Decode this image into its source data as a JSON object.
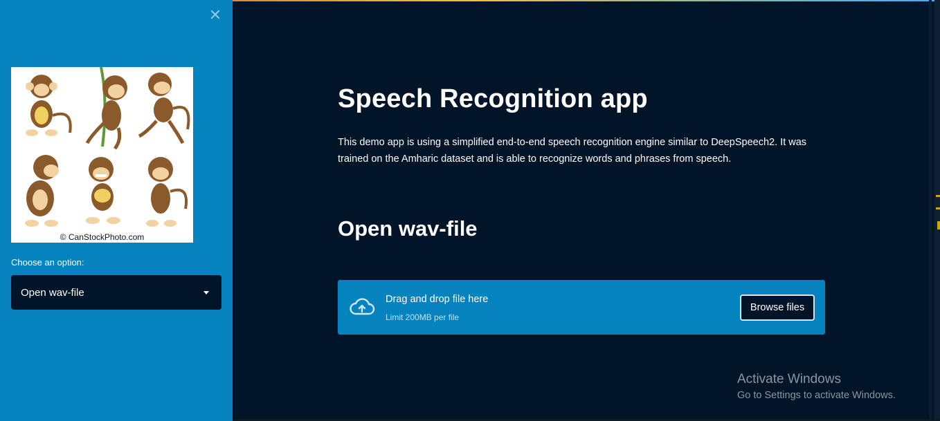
{
  "sidebar": {
    "close_icon": "close-icon",
    "image_credit": "© CanStockPhoto.com",
    "select_label": "Choose an option:",
    "select_value": "Open wav-file"
  },
  "main": {
    "title": "Speech Recognition app",
    "description": "This demo app is using a simplified end-to-end speech recognition engine similar to DeepSpeech2. It was trained on the Amharic dataset and is able to recognize words and phrases from speech.",
    "subtitle": "Open wav-file",
    "uploader": {
      "icon": "cloud-upload-icon",
      "drag_text": "Drag and drop file here",
      "limit_text": "Limit 200MB per file",
      "browse_label": "Browse files"
    }
  },
  "watermark": {
    "line1": "Activate Windows",
    "line2": "Go to Settings to activate Windows."
  },
  "colors": {
    "sidebar_bg": "#0583bf",
    "main_bg": "#021428",
    "accent": "#0583bf"
  }
}
